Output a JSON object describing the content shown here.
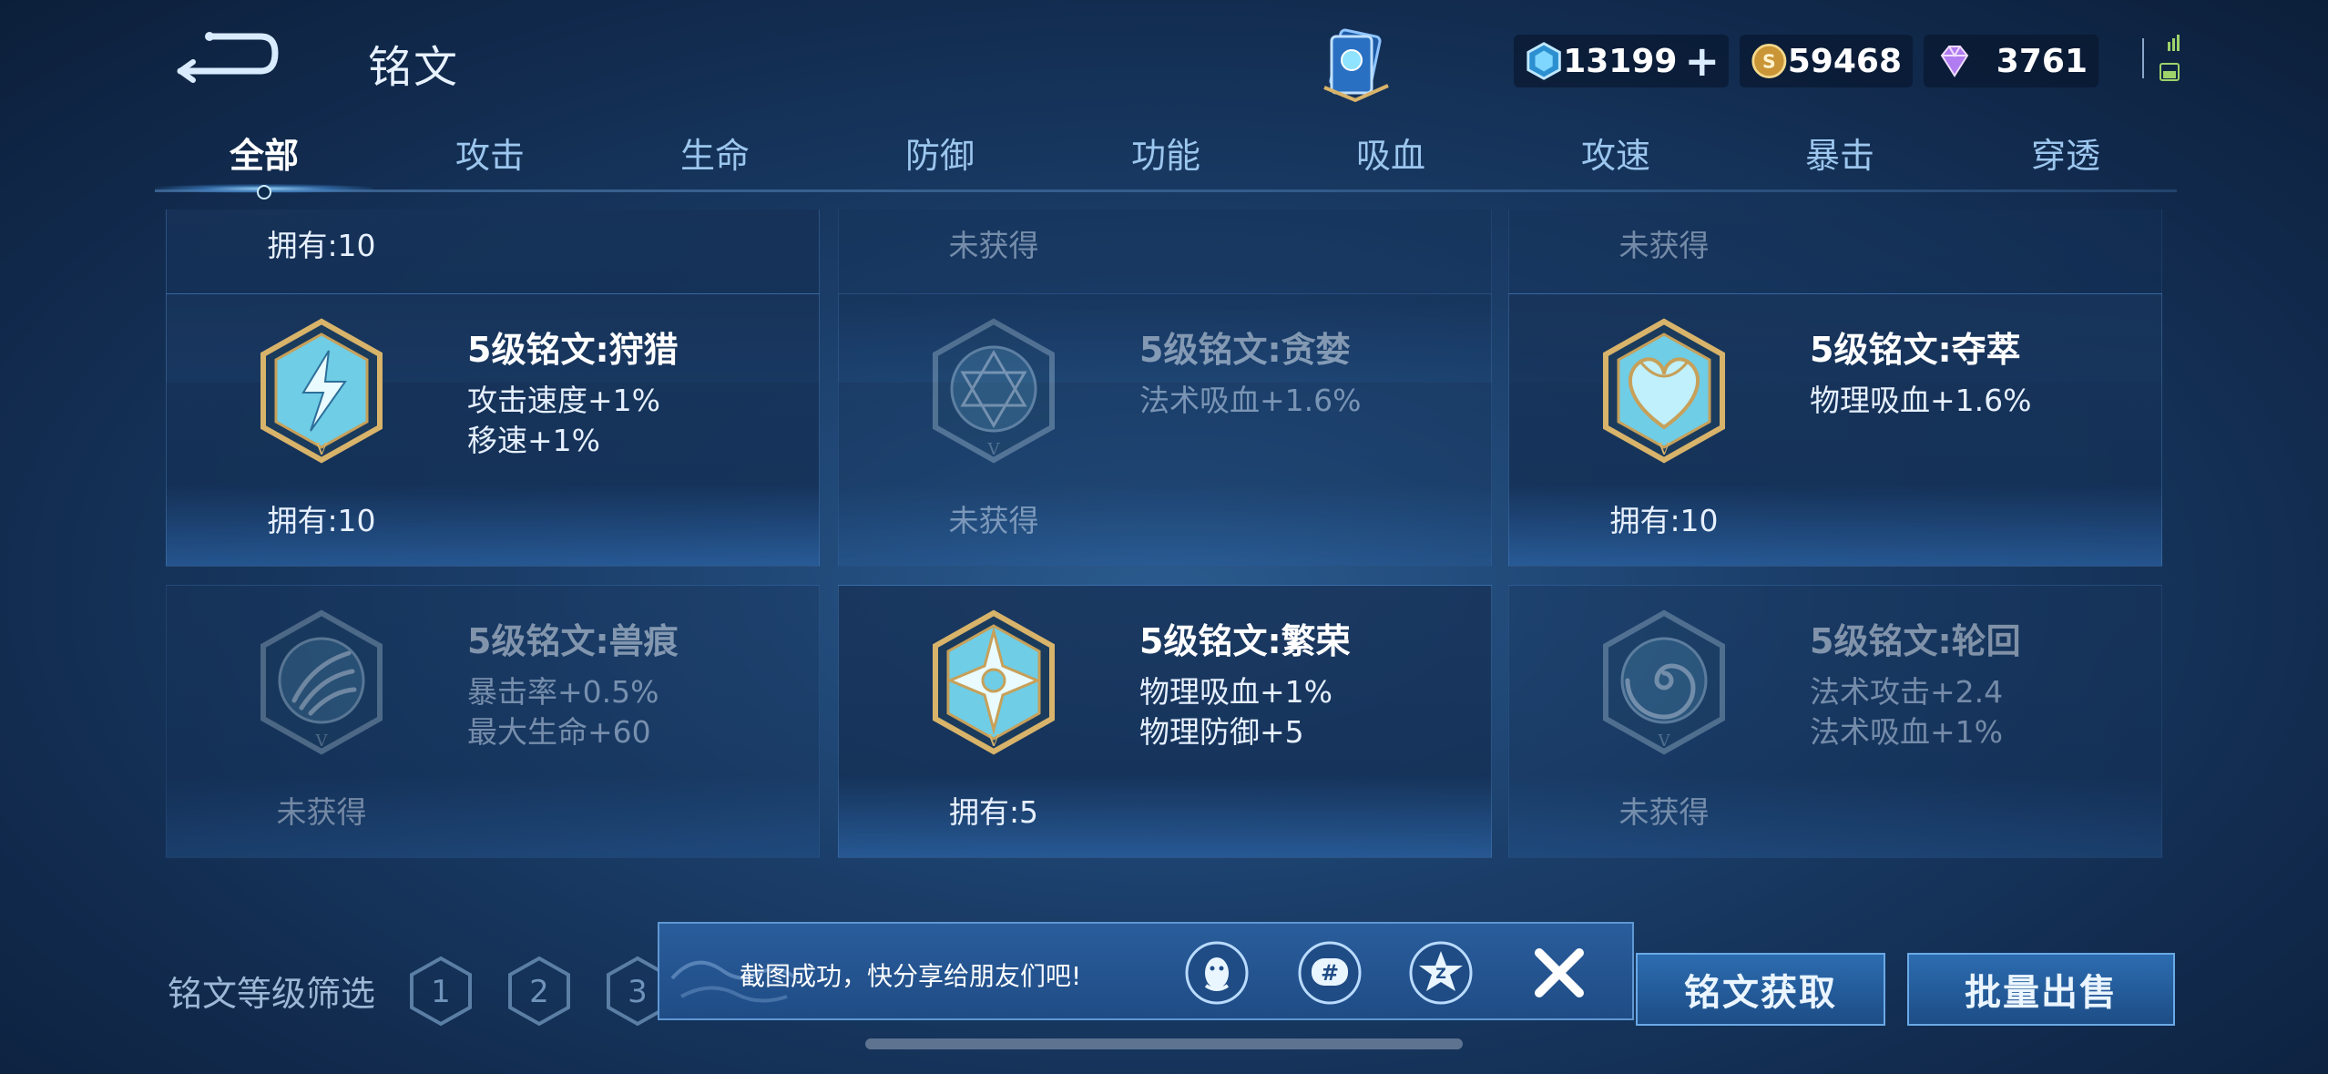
{
  "header": {
    "title": "铭文",
    "currencies": [
      {
        "icon": "crystal-coupon-icon",
        "value": "13199",
        "has_plus": true
      },
      {
        "icon": "gold-coin-icon",
        "value": "59468",
        "has_plus": false
      },
      {
        "icon": "diamond-icon",
        "value": "3761",
        "has_plus": false
      }
    ]
  },
  "tabs": [
    "全部",
    "攻击",
    "生命",
    "防御",
    "功能",
    "吸血",
    "攻速",
    "暴击",
    "穿透"
  ],
  "active_tab": "全部",
  "partial_row": [
    "拥有:10",
    "未获得",
    "未获得"
  ],
  "cards": [
    {
      "name": "5级铭文:狩猎",
      "stats": [
        "攻击速度+1%",
        "移速+1%"
      ],
      "owned": "拥有:10",
      "obtained": true,
      "color": "#7fd6ec",
      "icon": "lightning-rune-icon"
    },
    {
      "name": "5级铭文:贪婪",
      "stats": [
        "法术吸血+1.6%"
      ],
      "owned": "未获得",
      "obtained": false,
      "color": "#4d7a9a",
      "icon": "hexagram-rune-icon"
    },
    {
      "name": "5级铭文:夺萃",
      "stats": [
        "物理吸血+1.6%"
      ],
      "owned": "拥有:10",
      "obtained": true,
      "color": "#7fd6ec",
      "icon": "heart-rune-icon"
    },
    {
      "name": "5级铭文:兽痕",
      "stats": [
        "暴击率+0.5%",
        "最大生命+60"
      ],
      "owned": "未获得",
      "obtained": false,
      "color": "#4d7a9a",
      "icon": "claw-rune-icon"
    },
    {
      "name": "5级铭文:繁荣",
      "stats": [
        "物理吸血+1%",
        "物理防御+5"
      ],
      "owned": "拥有:5",
      "obtained": true,
      "color": "#7fd6ec",
      "icon": "star-rune-icon"
    },
    {
      "name": "5级铭文:轮回",
      "stats": [
        "法术攻击+2.4",
        "法术吸血+1%"
      ],
      "owned": "未获得",
      "obtained": false,
      "color": "#4d7a9a",
      "icon": "spiral-rune-icon"
    }
  ],
  "filter": {
    "label": "铭文等级筛选",
    "levels": [
      "1",
      "2",
      "3"
    ]
  },
  "buttons": {
    "obtain": "铭文获取",
    "bulk_sell": "批量出售"
  },
  "toast": {
    "text": "截图成功，快分享给朋友们吧!",
    "share_icons": [
      "qq-icon",
      "wechat-moments-icon",
      "qzone-icon"
    ]
  },
  "colors": {
    "accent": "#6aa9e6",
    "gold": "#d8b36a",
    "background": "#1a3d68"
  }
}
